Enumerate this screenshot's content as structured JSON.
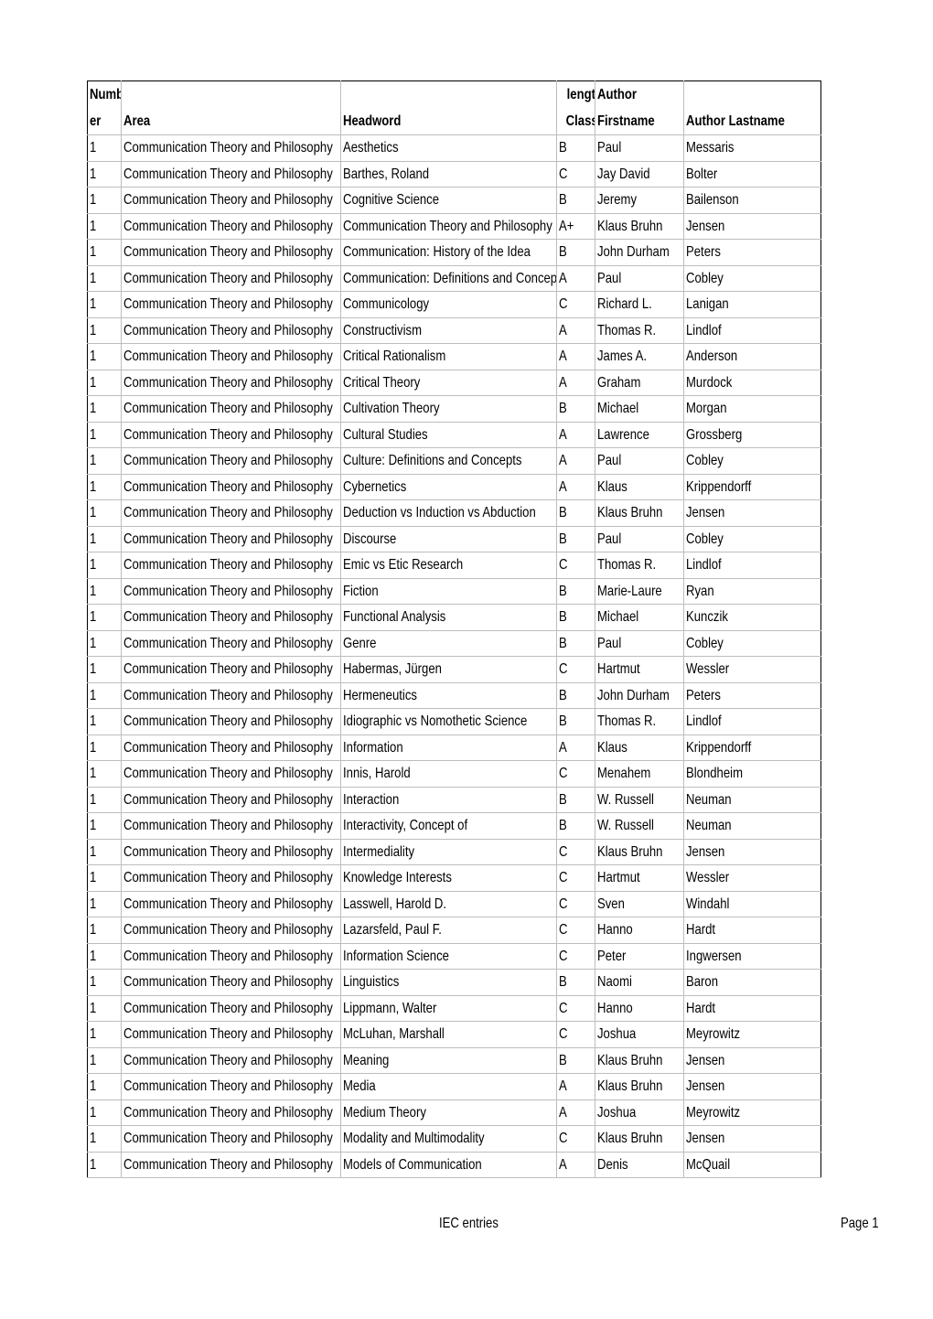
{
  "table": {
    "headers": {
      "number": [
        "Numb",
        "er"
      ],
      "area": "Area",
      "headword": "Headword",
      "length_class": [
        "length",
        "Class"
      ],
      "author_firstname": [
        "Author",
        "Firstname"
      ],
      "author_lastname": "Author Lastname"
    },
    "rows": [
      {
        "number": "1",
        "area": "Communication Theory and Philosophy",
        "headword": "Aesthetics",
        "class": "B",
        "firstname": "Paul",
        "lastname": "Messaris"
      },
      {
        "number": "1",
        "area": "Communication Theory and Philosophy",
        "headword": "Barthes, Roland",
        "class": "C",
        "firstname": "Jay David",
        "lastname": "Bolter"
      },
      {
        "number": "1",
        "area": "Communication Theory and Philosophy",
        "headword": "Cognitive Science",
        "class": "B",
        "firstname": "Jeremy",
        "lastname": "Bailenson"
      },
      {
        "number": "1",
        "area": "Communication Theory and Philosophy",
        "headword": "Communication Theory and Philosophy",
        "class": "A+",
        "firstname": "Klaus Bruhn",
        "lastname": "Jensen"
      },
      {
        "number": "1",
        "area": "Communication Theory and Philosophy",
        "headword": "Communication: History of the Idea",
        "class": "B",
        "firstname": "John Durham",
        "lastname": "Peters"
      },
      {
        "number": "1",
        "area": "Communication Theory and Philosophy",
        "headword": "Communication: Definitions and Concepts",
        "class": "A",
        "firstname": "Paul",
        "lastname": "Cobley"
      },
      {
        "number": "1",
        "area": "Communication Theory and Philosophy",
        "headword": "Communicology",
        "class": "C",
        "firstname": "Richard L.",
        "lastname": "Lanigan"
      },
      {
        "number": "1",
        "area": "Communication Theory and Philosophy",
        "headword": "Constructivism",
        "class": "A",
        "firstname": "Thomas R.",
        "lastname": "Lindlof"
      },
      {
        "number": "1",
        "area": "Communication Theory and Philosophy",
        "headword": "Critical Rationalism",
        "class": "A",
        "firstname": "James A.",
        "lastname": "Anderson"
      },
      {
        "number": "1",
        "area": "Communication Theory and Philosophy",
        "headword": "Critical Theory",
        "class": "A",
        "firstname": "Graham",
        "lastname": "Murdock"
      },
      {
        "number": "1",
        "area": "Communication Theory and Philosophy",
        "headword": "Cultivation Theory",
        "class": "B",
        "firstname": "Michael",
        "lastname": "Morgan"
      },
      {
        "number": "1",
        "area": "Communication Theory and Philosophy",
        "headword": "Cultural Studies",
        "class": "A",
        "firstname": "Lawrence",
        "lastname": "Grossberg"
      },
      {
        "number": "1",
        "area": "Communication Theory and Philosophy",
        "headword": "Culture: Definitions and Concepts",
        "class": "A",
        "firstname": "Paul",
        "lastname": "Cobley"
      },
      {
        "number": "1",
        "area": "Communication Theory and Philosophy",
        "headword": "Cybernetics",
        "class": "A",
        "firstname": "Klaus",
        "lastname": "Krippendorff"
      },
      {
        "number": "1",
        "area": "Communication Theory and Philosophy",
        "headword": "Deduction vs Induction vs Abduction",
        "class": "B",
        "firstname": "Klaus Bruhn",
        "lastname": "Jensen"
      },
      {
        "number": "1",
        "area": "Communication Theory and Philosophy",
        "headword": "Discourse",
        "class": "B",
        "firstname": "Paul",
        "lastname": "Cobley"
      },
      {
        "number": "1",
        "area": "Communication Theory and Philosophy",
        "headword": "Emic vs Etic Research",
        "class": "C",
        "firstname": "Thomas R.",
        "lastname": "Lindlof"
      },
      {
        "number": "1",
        "area": "Communication Theory and Philosophy",
        "headword": "Fiction",
        "class": "B",
        "firstname": "Marie-Laure",
        "lastname": "Ryan"
      },
      {
        "number": "1",
        "area": "Communication Theory and Philosophy",
        "headword": "Functional Analysis",
        "class": "B",
        "firstname": "Michael",
        "lastname": "Kunczik"
      },
      {
        "number": "1",
        "area": "Communication Theory and Philosophy",
        "headword": "Genre",
        "class": "B",
        "firstname": "Paul",
        "lastname": "Cobley"
      },
      {
        "number": "1",
        "area": "Communication Theory and Philosophy",
        "headword": "Habermas, Jürgen",
        "class": "C",
        "firstname": "Hartmut",
        "lastname": "Wessler"
      },
      {
        "number": "1",
        "area": "Communication Theory and Philosophy",
        "headword": "Hermeneutics",
        "class": "B",
        "firstname": "John Durham",
        "lastname": "Peters"
      },
      {
        "number": "1",
        "area": "Communication Theory and Philosophy",
        "headword": "Idiographic vs Nomothetic Science",
        "class": "B",
        "firstname": "Thomas R.",
        "lastname": "Lindlof"
      },
      {
        "number": "1",
        "area": "Communication Theory and Philosophy",
        "headword": "Information",
        "class": "A",
        "firstname": "Klaus",
        "lastname": "Krippendorff"
      },
      {
        "number": "1",
        "area": "Communication Theory and Philosophy",
        "headword": "Innis, Harold",
        "class": "C",
        "firstname": "Menahem",
        "lastname": "Blondheim"
      },
      {
        "number": "1",
        "area": "Communication Theory and Philosophy",
        "headword": "Interaction",
        "class": "B",
        "firstname": "W. Russell",
        "lastname": "Neuman"
      },
      {
        "number": "1",
        "area": "Communication Theory and Philosophy",
        "headword": "Interactivity, Concept of",
        "class": "B",
        "firstname": "W. Russell",
        "lastname": "Neuman"
      },
      {
        "number": "1",
        "area": "Communication Theory and Philosophy",
        "headword": "Intermediality",
        "class": "C",
        "firstname": "Klaus Bruhn",
        "lastname": "Jensen"
      },
      {
        "number": "1",
        "area": "Communication Theory and Philosophy",
        "headword": "Knowledge Interests",
        "class": "C",
        "firstname": "Hartmut",
        "lastname": "Wessler"
      },
      {
        "number": "1",
        "area": "Communication Theory and Philosophy",
        "headword": "Lasswell, Harold D.",
        "class": "C",
        "firstname": "Sven",
        "lastname": "Windahl"
      },
      {
        "number": "1",
        "area": "Communication Theory and Philosophy",
        "headword": "Lazarsfeld, Paul F.",
        "class": "C",
        "firstname": "Hanno",
        "lastname": "Hardt"
      },
      {
        "number": "1",
        "area": "Communication Theory and Philosophy",
        "headword": "Information Science",
        "class": "C",
        "firstname": "Peter",
        "lastname": "Ingwersen"
      },
      {
        "number": "1",
        "area": "Communication Theory and Philosophy",
        "headword": "Linguistics",
        "class": "B",
        "firstname": "Naomi",
        "lastname": "Baron"
      },
      {
        "number": "1",
        "area": "Communication Theory and Philosophy",
        "headword": "Lippmann, Walter",
        "class": "C",
        "firstname": "Hanno",
        "lastname": "Hardt"
      },
      {
        "number": "1",
        "area": "Communication Theory and Philosophy",
        "headword": "McLuhan, Marshall",
        "class": "C",
        "firstname": "Joshua",
        "lastname": "Meyrowitz"
      },
      {
        "number": "1",
        "area": "Communication Theory and Philosophy",
        "headword": "Meaning",
        "class": "B",
        "firstname": "Klaus Bruhn",
        "lastname": "Jensen"
      },
      {
        "number": "1",
        "area": "Communication Theory and Philosophy",
        "headword": "Media",
        "class": "A",
        "firstname": "Klaus Bruhn",
        "lastname": "Jensen"
      },
      {
        "number": "1",
        "area": "Communication Theory and Philosophy",
        "headword": "Medium Theory",
        "class": "A",
        "firstname": "Joshua",
        "lastname": "Meyrowitz"
      },
      {
        "number": "1",
        "area": "Communication Theory and Philosophy",
        "headword": "Modality and Multimodality",
        "class": "C",
        "firstname": "Klaus Bruhn",
        "lastname": "Jensen"
      },
      {
        "number": "1",
        "area": "Communication Theory and Philosophy",
        "headword": "Models of Communication",
        "class": "A",
        "firstname": "Denis",
        "lastname": "McQuail"
      }
    ]
  },
  "footer": {
    "sheet_name": "IEC entries",
    "page_label": "Page 1"
  }
}
